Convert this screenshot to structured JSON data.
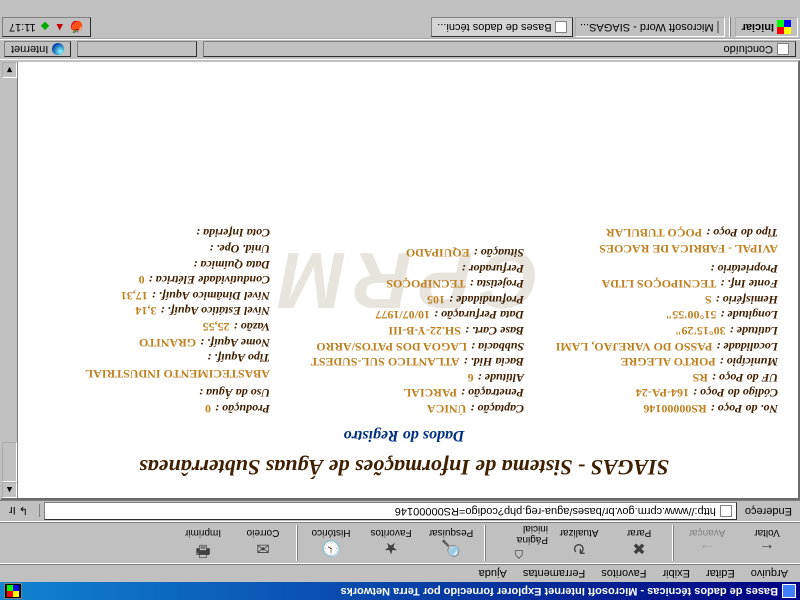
{
  "window": {
    "title": "Bases de dados técnicas - Microsoft Internet Explorer fornecido por Terra Networks"
  },
  "menubar": {
    "items": [
      "Arquivo",
      "Editar",
      "Exibir",
      "Favoritos",
      "Ferramentas",
      "Ajuda"
    ]
  },
  "toolbar": {
    "back": "Voltar",
    "forward": "Avançar",
    "stop": "Parar",
    "refresh": "Atualizar",
    "home": "Página inicial",
    "search": "Pesquisar",
    "favorites": "Favoritos",
    "history": "Histórico",
    "mail": "Correio",
    "print": "Imprimir"
  },
  "addressbar": {
    "label": "Endereço",
    "url": "http://www.cprm.gov.br/bases/agua-reg.php?codigo=RS00000146",
    "go_label": "Ir"
  },
  "page": {
    "title": "SIAGAS - Sistema de Informações de Águas Subterrâneas",
    "section": "Dados do Registro",
    "watermark": "CPRM",
    "fields": {
      "col1": [
        {
          "label": "No. do Poço :",
          "value": "RS00000146"
        },
        {
          "label": "Código do Poço :",
          "value": "164-PA-24"
        },
        {
          "label": "UF do Poço :",
          "value": "RS"
        },
        {
          "label": "Município :",
          "value": "PORTO ALEGRE"
        },
        {
          "label": "Localidade :",
          "value": "PASSO DO VAREJAO, LAMI"
        },
        {
          "label": "Latitude :",
          "value": "30°15'29\""
        },
        {
          "label": "Longitude :",
          "value": "51°00'55\""
        },
        {
          "label": "Hemisfério :",
          "value": "S"
        },
        {
          "label": "Fonte Inf. :",
          "value": "TECNIPOÇOS LTDA"
        },
        {
          "label": "Proprietário :",
          "value": "AVIPAL - FABRICA DE RACOES"
        },
        {
          "label": "Tipo do Poço :",
          "value": "POÇO TUBULAR"
        }
      ],
      "col2": [
        {
          "label": "Captação :",
          "value": "ÚNICA"
        },
        {
          "label": "Penetração :",
          "value": "PARCIAL"
        },
        {
          "label": "Altitude :",
          "value": "6"
        },
        {
          "label": "Bacia Hid. :",
          "value": "ATLANTICO SUL-SUDEST"
        },
        {
          "label": "Subbacia :",
          "value": "LAGOA DOS PATOS/ARRO"
        },
        {
          "label": "Base Cart. :",
          "value": "SH.22-Y-B-III"
        },
        {
          "label": "Data Perfuração :",
          "value": "10/07/1977"
        },
        {
          "label": "Profundidade :",
          "value": "105"
        },
        {
          "label": "Projetista :",
          "value": "TECNIPOÇOS"
        },
        {
          "label": "Perfurador :",
          "value": ""
        },
        {
          "label": "Situação :",
          "value": "EQUIPADO"
        }
      ],
      "col3": [
        {
          "label": "Produção :",
          "value": "0"
        },
        {
          "label": "Uso da Água :",
          "value": "ABASTECIMENTO INDUSTRIAL"
        },
        {
          "label": "Tipo Aquíf. :",
          "value": ""
        },
        {
          "label": "Nome Aquíf. :",
          "value": "GRANITO"
        },
        {
          "label": "Vazão :",
          "value": "25,55"
        },
        {
          "label": "Nível Estático Aquíf. :",
          "value": "3,14"
        },
        {
          "label": "Nível Dinâmico Aquíf. :",
          "value": "17,31"
        },
        {
          "label": "Condutividade Elétrica :",
          "value": "0"
        },
        {
          "label": "Data Química :",
          "value": ""
        },
        {
          "label": "Unid. Ope. :",
          "value": ""
        },
        {
          "label": "Cota Inferida :",
          "value": ""
        }
      ]
    }
  },
  "statusbar": {
    "left": "Concluído",
    "zone": "Internet"
  },
  "taskbar": {
    "start": "Iniciar",
    "items": [
      {
        "label": "Microsoft Word - SIAGAS...",
        "active": false
      },
      {
        "label": "Bases de dados técni...",
        "active": true
      }
    ],
    "clock": "11:17"
  }
}
